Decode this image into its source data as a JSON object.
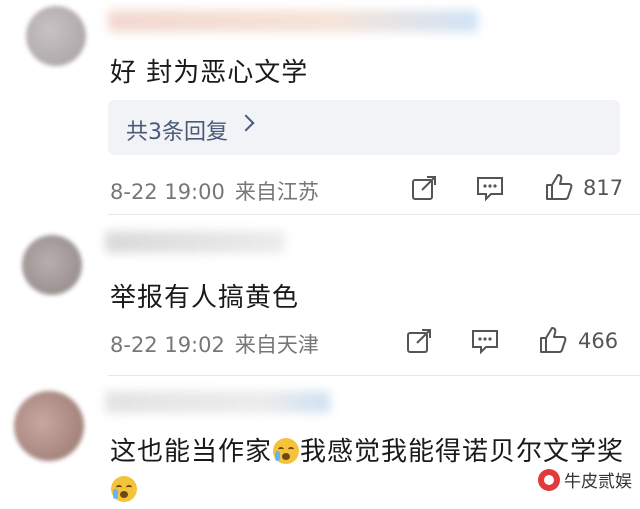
{
  "comments": [
    {
      "text": "好 封为恶心文学",
      "reply_label": "共3条回复",
      "date": "8-22 19:00",
      "location": "来自江苏",
      "likes": "817"
    },
    {
      "text": "举报有人搞黄色",
      "date": "8-22 19:02",
      "location": "来自天津",
      "likes": "466"
    },
    {
      "text_part1": "这也能当作家",
      "text_part2": "我感觉我能得诺贝尔文学奖",
      "emoji": "crying-face"
    }
  ],
  "watermark": "牛皮贰娱"
}
